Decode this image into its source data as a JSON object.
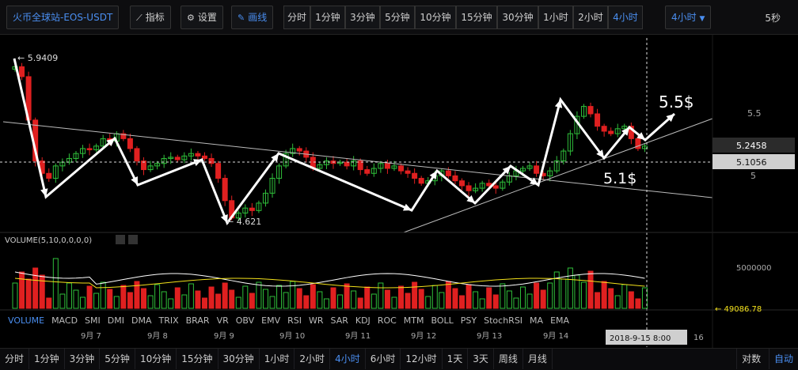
{
  "toolbar": {
    "symbol": "火币全球站-EOS-USDT",
    "indicators_label": "指标",
    "settings_label": "设置",
    "draw_label": "画线",
    "intervals": [
      "分时",
      "1分钟",
      "3分钟",
      "5分钟",
      "10分钟",
      "15分钟",
      "30分钟",
      "1小时",
      "2小时",
      "4小时"
    ],
    "active_interval": "4小时",
    "dropdown_value": "4小时",
    "countdown": "5秒"
  },
  "chart": {
    "high_label": "5.9409",
    "low_label": "4.621",
    "price_axis_ticks": [
      "5.5",
      "5"
    ],
    "current_price": "5.2458",
    "crosshair_price": "5.1056",
    "annotation_top": "5.5$",
    "annotation_bottom": "5.1$",
    "volume_title": "VOLUME(5,10,0,0,0,0)",
    "volume_axis_tick": "5000000",
    "volume_last": "49086.78",
    "date_labels": [
      "9月 7",
      "9月 8",
      "9月 9",
      "9月 10",
      "9月 11",
      "9月 12",
      "9月 13",
      "9月 14"
    ],
    "crosshair_time": "2018-9-15 8:00",
    "date_partial": "16",
    "colors": {
      "up": "#2fbf3a",
      "down": "#e02020",
      "ma1": "#ffffff",
      "ma2": "#f3e11a",
      "accent": "#4a8ef0"
    }
  },
  "indicators": [
    "VOLUME",
    "MACD",
    "SMI",
    "DMI",
    "DMA",
    "TRIX",
    "BRAR",
    "VR",
    "OBV",
    "EMV",
    "RSI",
    "WR",
    "SAR",
    "KDJ",
    "ROC",
    "MTM",
    "BOLL",
    "PSY",
    "StochRSI",
    "MA",
    "EMA"
  ],
  "active_indicator": "VOLUME",
  "bottombar": {
    "intervals": [
      "分时",
      "1分钟",
      "3分钟",
      "5分钟",
      "10分钟",
      "15分钟",
      "30分钟",
      "1小时",
      "2小时",
      "4小时",
      "6小时",
      "12小时",
      "1天",
      "3天",
      "周线",
      "月线"
    ],
    "active": "4小时",
    "log_label": "对数",
    "auto_label": "自动"
  }
}
